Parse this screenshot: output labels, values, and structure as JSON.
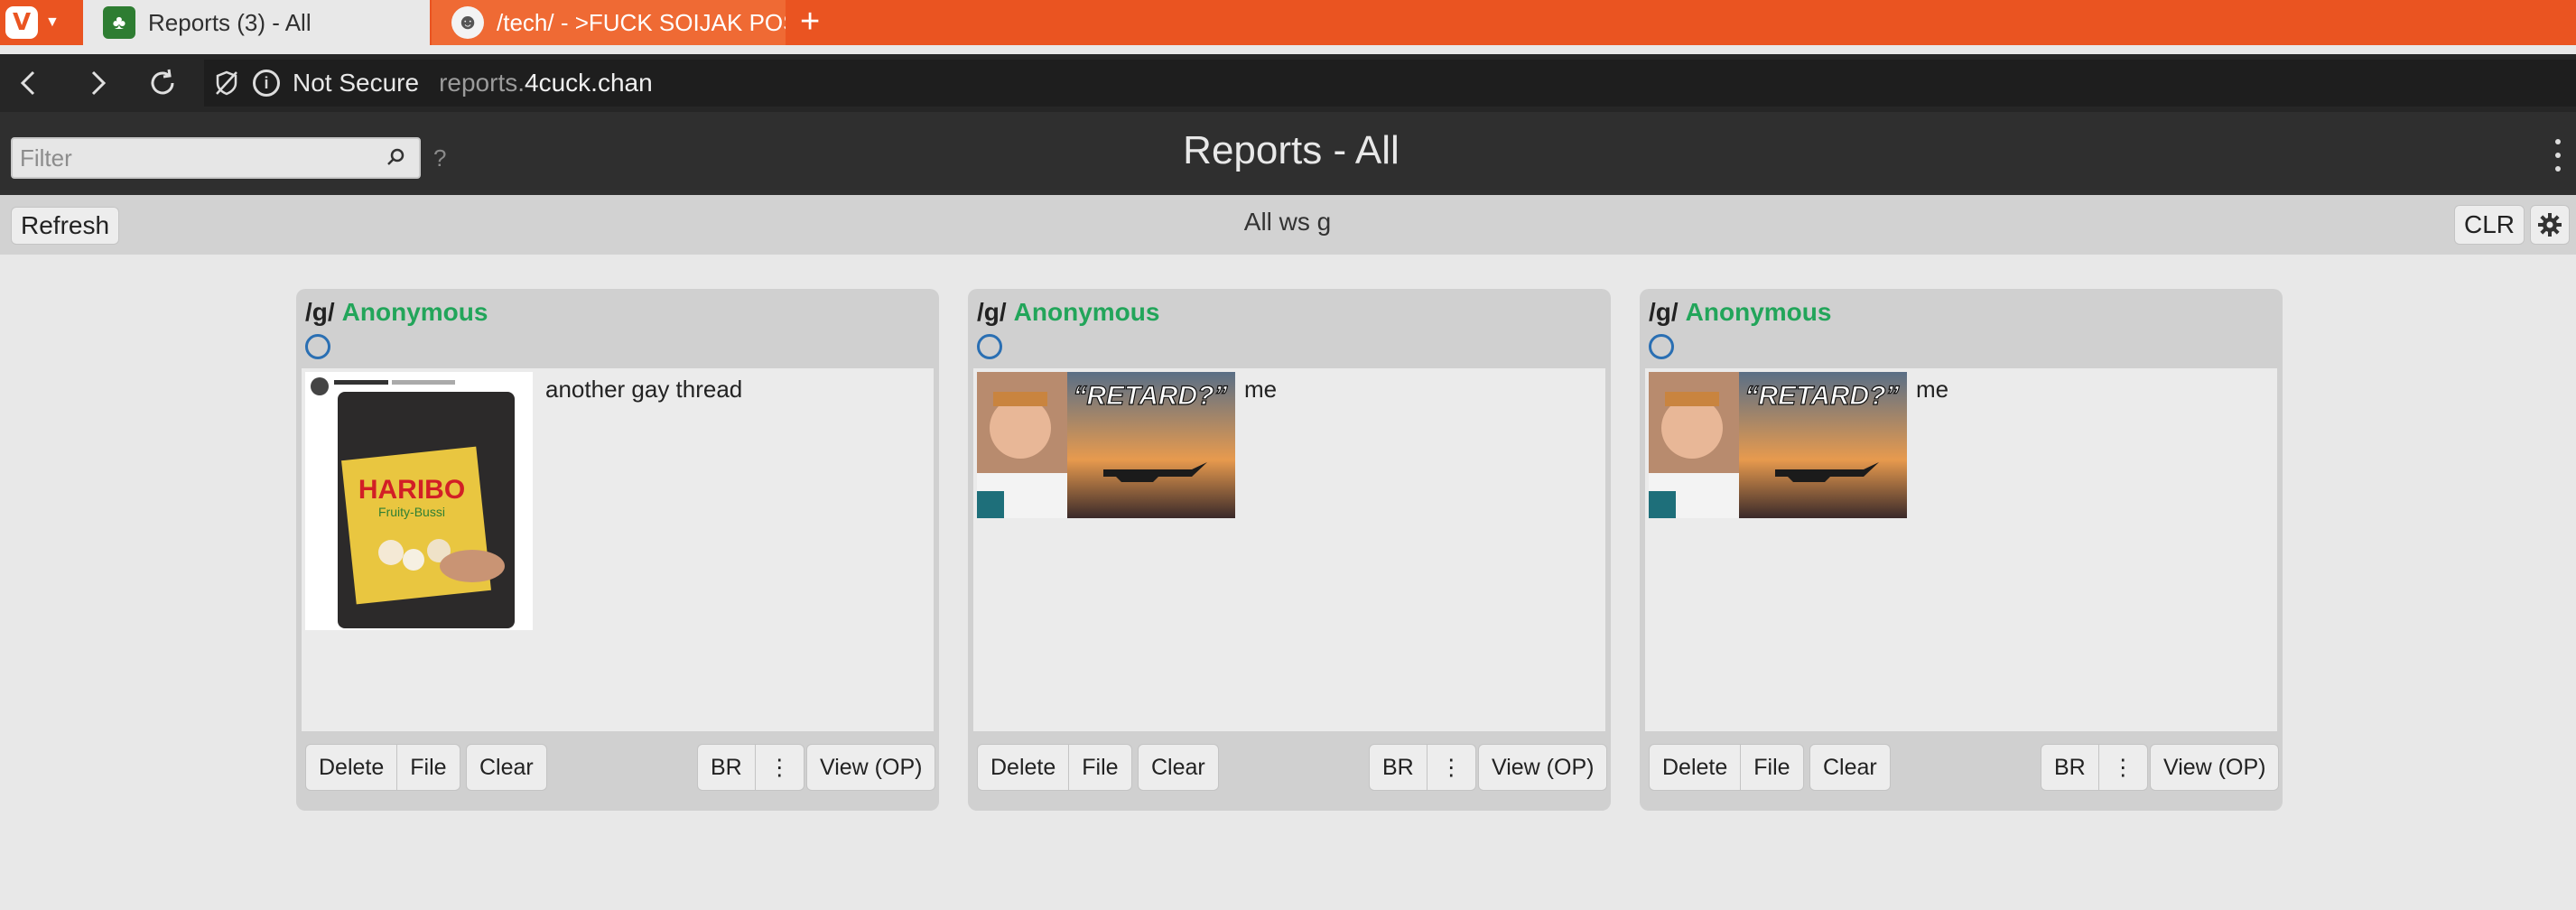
{
  "browser": {
    "tabs": [
      {
        "label": "Reports (3) - All",
        "icon": "clover-favicon-icon",
        "active": true
      },
      {
        "label": "/tech/ - >FUCK SOIJAK POS",
        "icon": "face-favicon-icon",
        "active": false
      }
    ],
    "new_tab_label": "+",
    "vivaldi_logo": "V",
    "address": {
      "security_text": "Not Secure",
      "url_prefix": "reports.",
      "url_domain": "4cuck.chan"
    }
  },
  "header": {
    "filter_placeholder": "Filter",
    "help_label": "?",
    "title": "Reports - All"
  },
  "toolbar": {
    "refresh_label": "Refresh",
    "filter_summary": "All ws g",
    "clr_label": "CLR"
  },
  "reports": [
    {
      "board": "/g/",
      "poster": "Anonymous",
      "comment": "another gay thread",
      "thumbnail": {
        "type": "tweet-screenshot",
        "product_text": "HARIBO",
        "subtext": "Fruity-Bussi"
      },
      "actions": {
        "delete": "Delete",
        "file": "File",
        "clear": "Clear",
        "br": "BR",
        "more": "⋮",
        "view": "View (OP)"
      }
    },
    {
      "board": "/g/",
      "poster": "Anonymous",
      "comment": "me",
      "thumbnail": {
        "type": "pilot-video-thumbnail",
        "caption": "“RETARD?”"
      },
      "actions": {
        "delete": "Delete",
        "file": "File",
        "clear": "Clear",
        "br": "BR",
        "more": "⋮",
        "view": "View (OP)"
      }
    },
    {
      "board": "/g/",
      "poster": "Anonymous",
      "comment": "me",
      "thumbnail": {
        "type": "pilot-video-thumbnail",
        "caption": "“RETARD?”"
      },
      "actions": {
        "delete": "Delete",
        "file": "File",
        "clear": "Clear",
        "br": "BR",
        "more": "⋮",
        "view": "View (OP)"
      }
    }
  ],
  "colors": {
    "tabbar": "#ea5421",
    "poster_name": "#22a55a",
    "header_bg": "#2f2f2f",
    "toolbar_bg": "#d2d2d2"
  }
}
